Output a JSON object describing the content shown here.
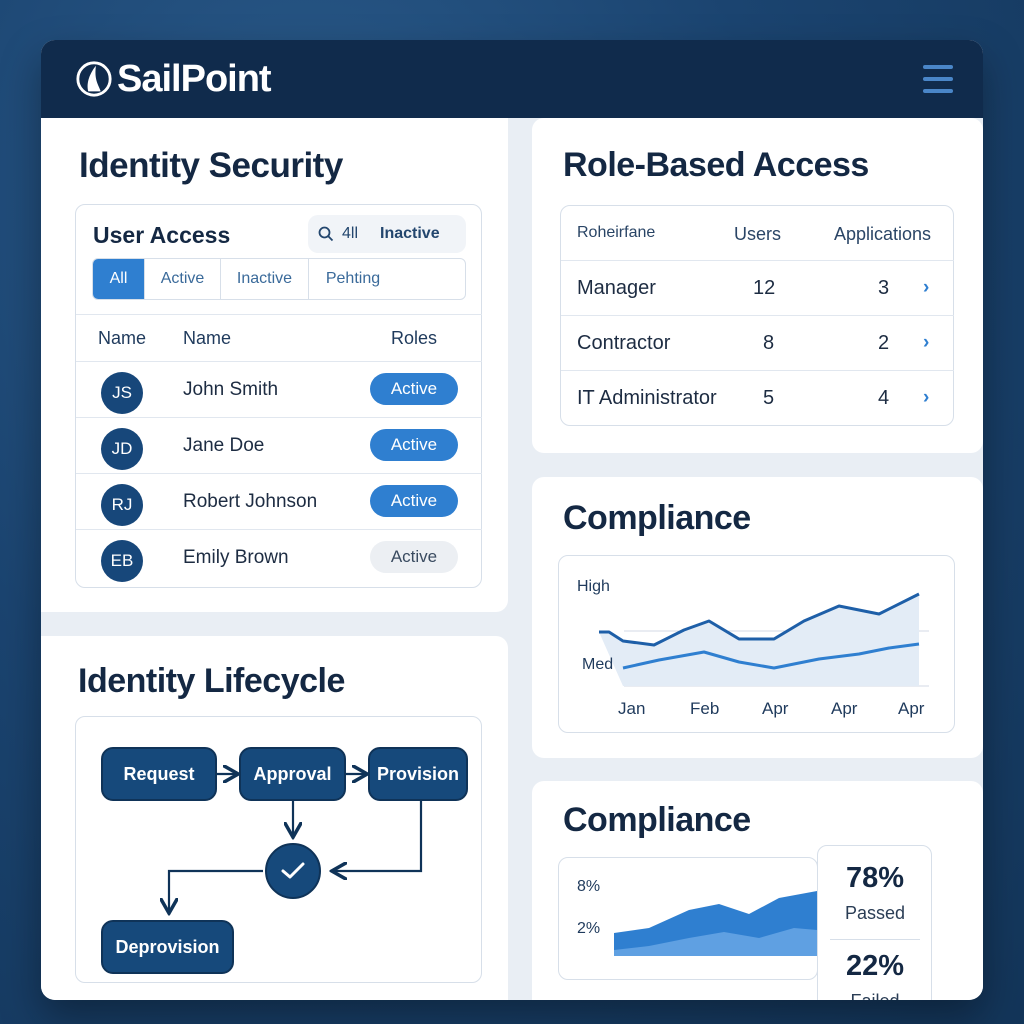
{
  "header": {
    "brand": "SailPoint",
    "logo_icon": "sail-logo-icon",
    "menu_icon": "hamburger-menu-icon"
  },
  "identity_security": {
    "title": "Identity Security",
    "user_access": {
      "title": "User Access",
      "search_text": "4ll",
      "search_filter": "Inactive",
      "filters": [
        "All",
        "Active",
        "Inactive",
        "Pehting"
      ],
      "selected_filter": "All",
      "columns": [
        "Name",
        "Name",
        "Roles"
      ],
      "rows": [
        {
          "initials": "JS",
          "name": "John Smith",
          "status": "Active",
          "highlight": true
        },
        {
          "initials": "JD",
          "name": "Jane Doe",
          "status": "Active",
          "highlight": true
        },
        {
          "initials": "RJ",
          "name": "Robert Johnson",
          "status": "Active",
          "highlight": true
        },
        {
          "initials": "EB",
          "name": "Emily Brown",
          "status": "Active",
          "highlight": false
        }
      ]
    }
  },
  "role_based_access": {
    "title": "Role-Based Access",
    "columns": [
      "Roheirfane",
      "Users",
      "Applications"
    ],
    "rows": [
      {
        "role": "Manager",
        "users": "12",
        "applications": "3"
      },
      {
        "role": "Contractor",
        "users": "8",
        "applications": "2"
      },
      {
        "role": "IT Administrator",
        "users": "5",
        "applications": "4"
      }
    ]
  },
  "compliance_trend": {
    "title": "Compliance",
    "y_labels": [
      "High",
      "Med"
    ],
    "x_labels": [
      "Jan",
      "Feb",
      "Apr",
      "Apr",
      "Apr"
    ]
  },
  "identity_lifecycle": {
    "title": "Identity Lifecycle",
    "nodes": [
      "Request",
      "Approval",
      "Provision",
      "Deprovision"
    ],
    "check_icon": "checkmark-icon"
  },
  "compliance_summary": {
    "title": "Compliance",
    "y_labels": [
      "8%",
      "2%"
    ],
    "passed_pct": "78%",
    "passed_label": "Passed",
    "failed_pct": "22%",
    "failed_label": "Failed"
  },
  "colors": {
    "accent": "#2f7fd0",
    "navy": "#102b4c",
    "node": "#16497b"
  }
}
